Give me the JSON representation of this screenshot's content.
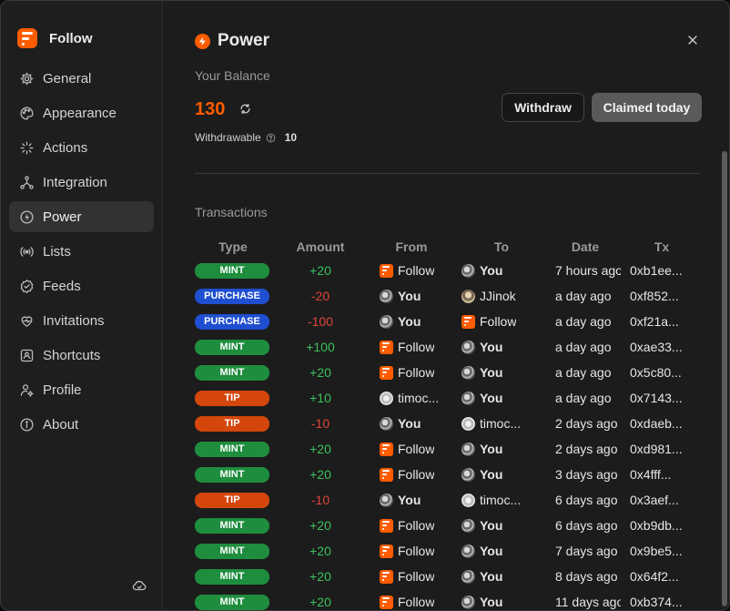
{
  "app": {
    "name": "Follow"
  },
  "sidebar": {
    "items": [
      {
        "label": "General",
        "icon": "gear-icon",
        "active": false
      },
      {
        "label": "Appearance",
        "icon": "palette-icon",
        "active": false
      },
      {
        "label": "Actions",
        "icon": "sparkle-icon",
        "active": false
      },
      {
        "label": "Integration",
        "icon": "integration-icon",
        "active": false
      },
      {
        "label": "Power",
        "icon": "power-icon",
        "active": true
      },
      {
        "label": "Lists",
        "icon": "broadcast-icon",
        "active": false
      },
      {
        "label": "Feeds",
        "icon": "badge-check-icon",
        "active": false
      },
      {
        "label": "Invitations",
        "icon": "heart-icon",
        "active": false
      },
      {
        "label": "Shortcuts",
        "icon": "keyboard-icon",
        "active": false
      },
      {
        "label": "Profile",
        "icon": "user-gear-icon",
        "active": false
      },
      {
        "label": "About",
        "icon": "info-icon",
        "active": false
      }
    ],
    "footer_icon": "cloud-icon"
  },
  "header": {
    "title": "Power"
  },
  "balance": {
    "label": "Your Balance",
    "value": "130",
    "withdrawable_label": "Withdrawable",
    "withdrawable_value": "10"
  },
  "buttons": {
    "withdraw": "Withdraw",
    "claimed": "Claimed today"
  },
  "transactions": {
    "label": "Transactions",
    "columns": [
      "Type",
      "Amount",
      "From",
      "To",
      "Date",
      "Tx"
    ],
    "rows": [
      {
        "type": "MINT",
        "amount": "+20",
        "from": "Follow",
        "to": "You",
        "date": "7 hours ago",
        "tx": "0xb1ee..."
      },
      {
        "type": "PURCHASE",
        "amount": "-20",
        "from": "You",
        "to": "JJinok",
        "date": "a day ago",
        "tx": "0xf852..."
      },
      {
        "type": "PURCHASE",
        "amount": "-100",
        "from": "You",
        "to": "Follow",
        "date": "a day ago",
        "tx": "0xf21a..."
      },
      {
        "type": "MINT",
        "amount": "+100",
        "from": "Follow",
        "to": "You",
        "date": "a day ago",
        "tx": "0xae33..."
      },
      {
        "type": "MINT",
        "amount": "+20",
        "from": "Follow",
        "to": "You",
        "date": "a day ago",
        "tx": "0x5c80..."
      },
      {
        "type": "TIP",
        "amount": "+10",
        "from": "timoc...",
        "to": "You",
        "date": "a day ago",
        "tx": "0x7143..."
      },
      {
        "type": "TIP",
        "amount": "-10",
        "from": "You",
        "to": "timoc...",
        "date": "2 days ago",
        "tx": "0xdaeb..."
      },
      {
        "type": "MINT",
        "amount": "+20",
        "from": "Follow",
        "to": "You",
        "date": "2 days ago",
        "tx": "0xd981..."
      },
      {
        "type": "MINT",
        "amount": "+20",
        "from": "Follow",
        "to": "You",
        "date": "3 days ago",
        "tx": "0x4fff..."
      },
      {
        "type": "TIP",
        "amount": "-10",
        "from": "You",
        "to": "timoc...",
        "date": "6 days ago",
        "tx": "0x3aef..."
      },
      {
        "type": "MINT",
        "amount": "+20",
        "from": "Follow",
        "to": "You",
        "date": "6 days ago",
        "tx": "0xb9db..."
      },
      {
        "type": "MINT",
        "amount": "+20",
        "from": "Follow",
        "to": "You",
        "date": "7 days ago",
        "tx": "0x9be5..."
      },
      {
        "type": "MINT",
        "amount": "+20",
        "from": "Follow",
        "to": "You",
        "date": "8 days ago",
        "tx": "0x64f2..."
      },
      {
        "type": "MINT",
        "amount": "+20",
        "from": "Follow",
        "to": "You",
        "date": "11 days ago",
        "tx": "0xb374..."
      }
    ]
  },
  "colors": {
    "accent": "#ff5c00",
    "positive": "#3ac25c",
    "negative": "#e0443a",
    "mint": "#1e8e3e",
    "purchase": "#1f4fd1",
    "tip": "#d4460c"
  }
}
